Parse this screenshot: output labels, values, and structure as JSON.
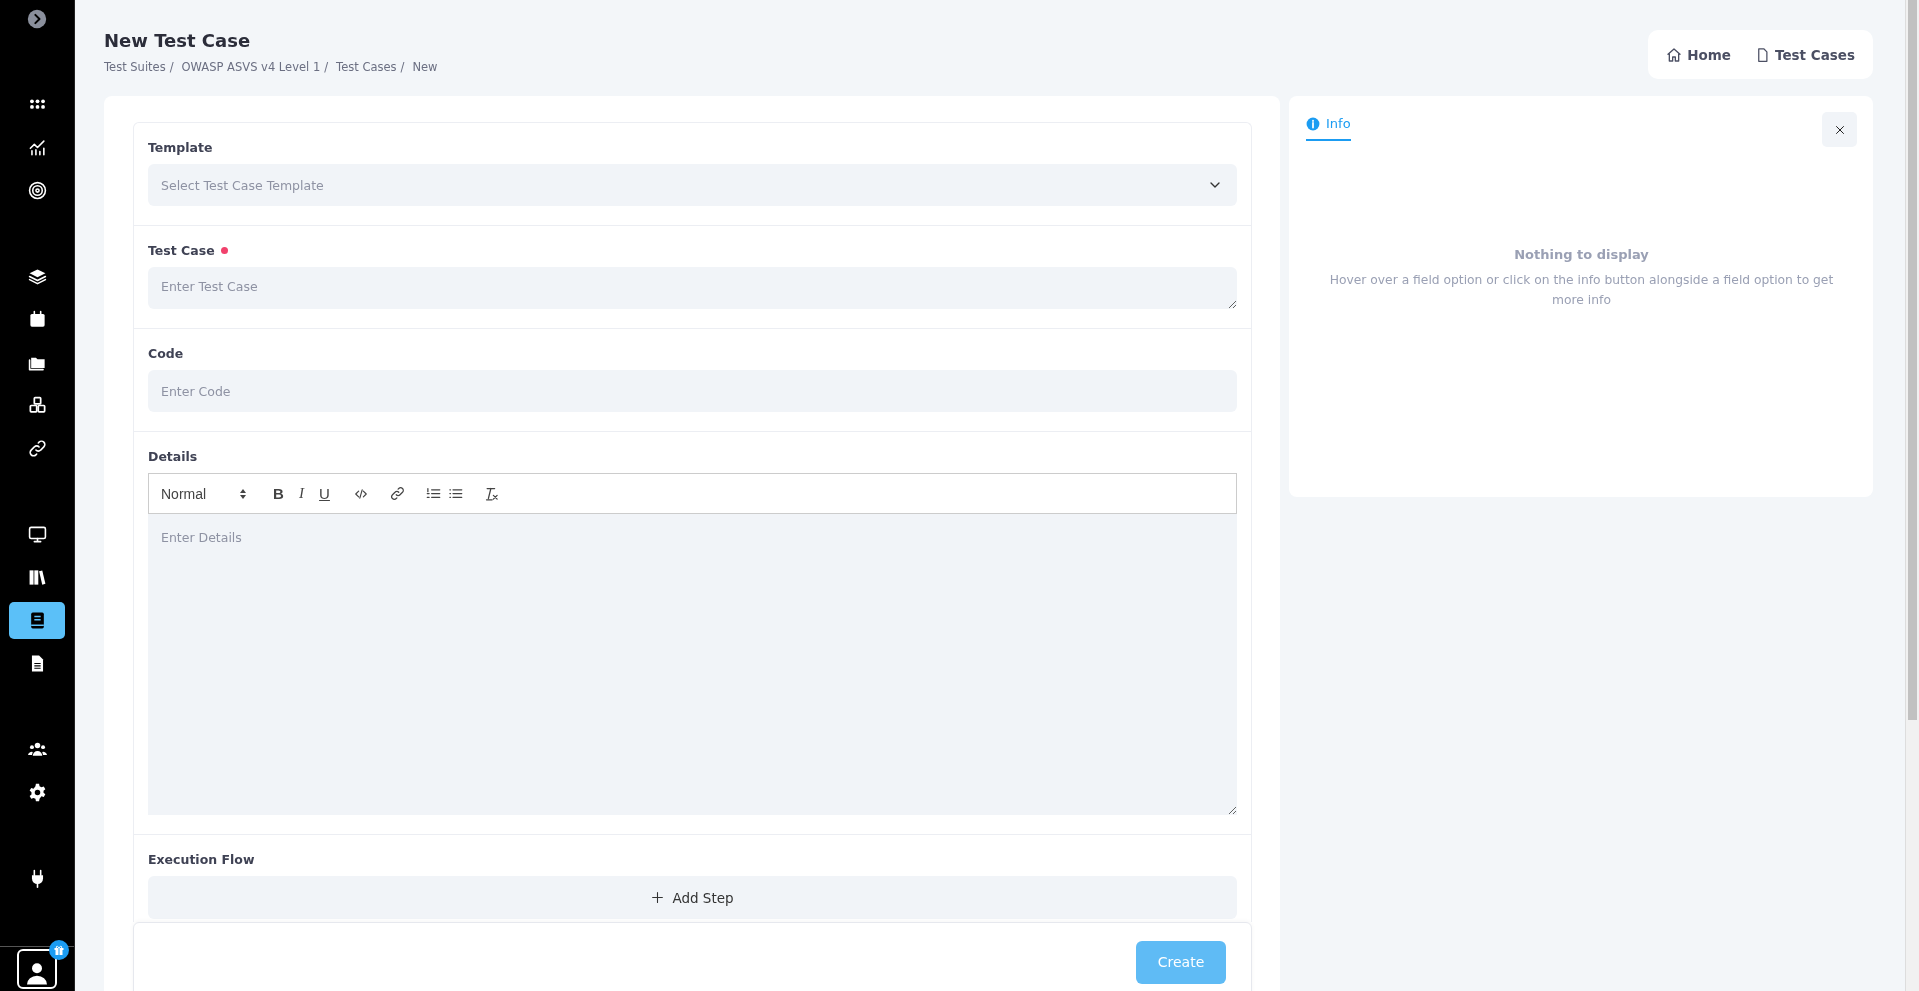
{
  "sidebar": {
    "groups": [
      {
        "items": [
          {
            "selected": false
          }
        ]
      },
      {
        "items": [
          {
            "selected": false
          },
          {
            "selected": false
          },
          {
            "selected": false
          }
        ]
      },
      {
        "items": [
          {
            "selected": false
          },
          {
            "selected": false
          },
          {
            "selected": false
          },
          {
            "selected": false
          },
          {
            "selected": false
          }
        ]
      },
      {
        "items": [
          {
            "selected": false
          },
          {
            "selected": false
          },
          {
            "selected": true
          },
          {
            "selected": false
          }
        ]
      },
      {
        "items": [
          {
            "selected": false
          },
          {
            "selected": false
          }
        ]
      },
      {
        "items": [
          {
            "selected": false
          }
        ]
      }
    ]
  },
  "header": {
    "title": "New Test Case",
    "breadcrumb": [
      "Test Suites",
      "OWASP ASVS v4 Level 1",
      "Test Cases",
      "New"
    ],
    "separator": "/",
    "links": [
      "Home",
      "Test Cases"
    ]
  },
  "form": {
    "fields": [
      {
        "kind": "select",
        "label": "Template",
        "placeholder": "Select Test Case Template",
        "required": false
      },
      {
        "kind": "textarea",
        "label": "Test Case",
        "placeholder": "Enter Test Case",
        "required": true
      },
      {
        "kind": "input",
        "label": "Code",
        "placeholder": "Enter Code",
        "required": false
      },
      {
        "kind": "editor",
        "label": "Details",
        "placeholder": "Enter Details",
        "required": false,
        "toolbar": {
          "heading": "Normal",
          "format_buttons": [
            "B",
            "I",
            "U"
          ]
        }
      },
      {
        "kind": "steps",
        "label": "Execution Flow",
        "button": "Add Step",
        "required": false
      }
    ],
    "submit": {
      "label": "Create",
      "disabled": true
    }
  },
  "info_panel": {
    "tabs": [
      {
        "label": "Info",
        "selected": true
      }
    ],
    "empty_title": "Nothing to display",
    "empty_text": "Hover over a field option or click on the info button alongside a field option to get more info"
  }
}
